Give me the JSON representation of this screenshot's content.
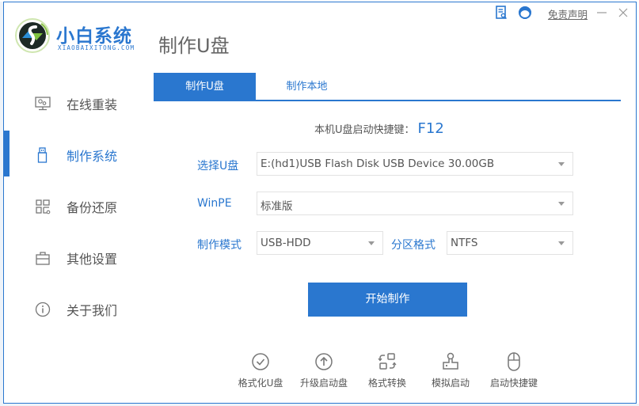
{
  "app": {
    "logo_title": "小白系统",
    "logo_subtitle": "XIAOBAIXITONG.COM",
    "page_title": "制作U盘"
  },
  "titlebar": {
    "doc_icon": "document-search-icon",
    "service_icon": "customer-service-icon",
    "disclaimer": "免责声明",
    "minimize_icon": "minimize-icon",
    "close_icon": "close-icon"
  },
  "sidebar": {
    "items": [
      {
        "label": "在线重装",
        "icon": "monitor-icon",
        "active": false
      },
      {
        "label": "制作系统",
        "icon": "usb-drive-icon",
        "active": true
      },
      {
        "label": "备份还原",
        "icon": "backup-grid-icon",
        "active": false
      },
      {
        "label": "其他设置",
        "icon": "toolbox-icon",
        "active": false
      },
      {
        "label": "关于我们",
        "icon": "info-icon",
        "active": false
      }
    ]
  },
  "tabs": [
    {
      "label": "制作U盘",
      "active": true
    },
    {
      "label": "制作本地",
      "active": false
    }
  ],
  "hotkey": {
    "label": "本机U盘启动快捷键：",
    "value": "F12"
  },
  "form": {
    "usb": {
      "label": "选择U盘",
      "value": "E:(hd1)USB Flash Disk USB Device 30.00GB"
    },
    "winpe": {
      "label": "WinPE",
      "value": "标准版"
    },
    "mode": {
      "label": "制作模式",
      "value": "USB-HDD"
    },
    "partition": {
      "label": "分区格式",
      "value": "NTFS"
    }
  },
  "start_button": "开始制作",
  "tools": [
    {
      "label": "格式化U盘",
      "icon": "check-circle-icon"
    },
    {
      "label": "升级启动盘",
      "icon": "upload-circle-icon"
    },
    {
      "label": "格式转换",
      "icon": "convert-icon"
    },
    {
      "label": "模拟启动",
      "icon": "stamp-icon"
    },
    {
      "label": "启动快捷键",
      "icon": "mouse-icon"
    }
  ],
  "colors": {
    "accent": "#2a77cf",
    "text": "#555555",
    "border": "#e2e2e2"
  }
}
